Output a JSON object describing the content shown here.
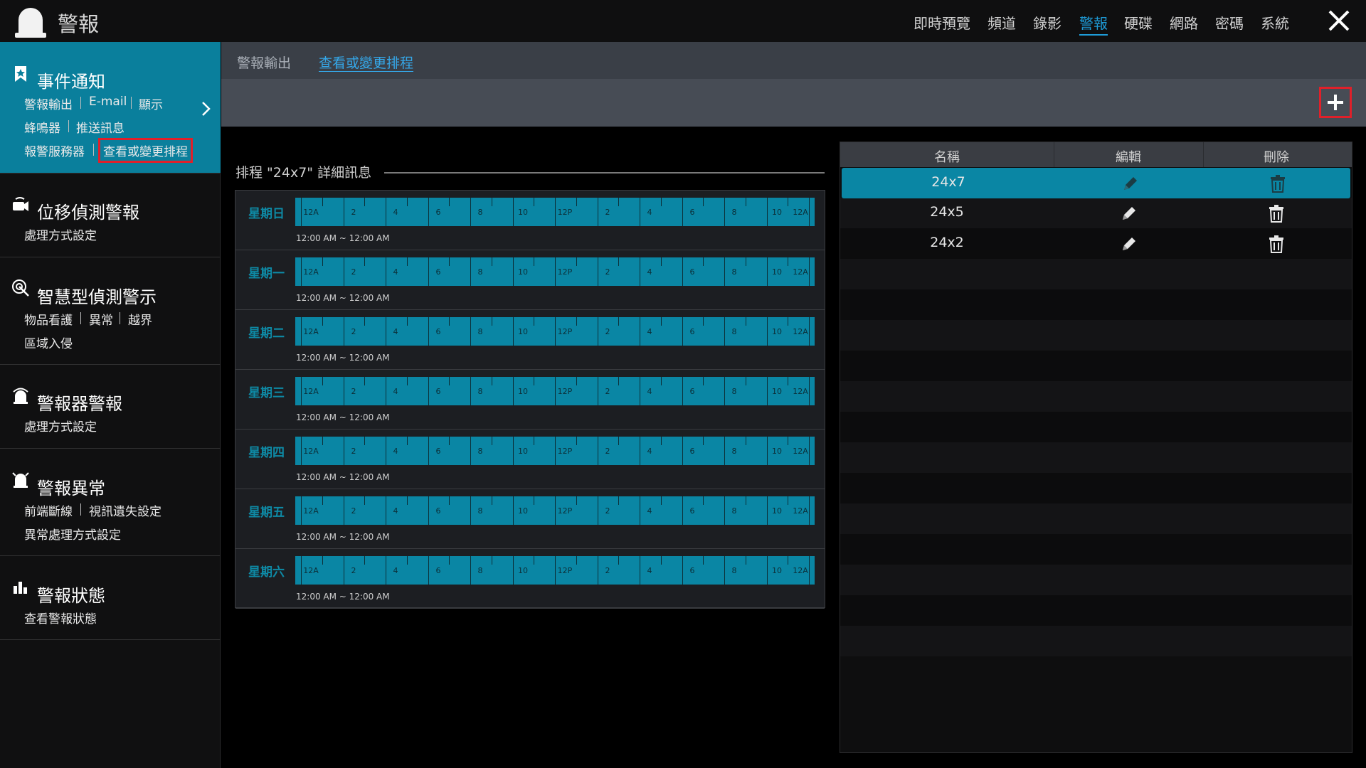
{
  "header": {
    "title": "警報",
    "nav": [
      {
        "label": "即時預覽",
        "active": false
      },
      {
        "label": "頻道",
        "active": false
      },
      {
        "label": "錄影",
        "active": false
      },
      {
        "label": "警報",
        "active": true
      },
      {
        "label": "硬碟",
        "active": false
      },
      {
        "label": "網路",
        "active": false
      },
      {
        "label": "密碼",
        "active": false
      },
      {
        "label": "系統",
        "active": false
      }
    ],
    "close_icon": "close-icon",
    "app_icon": "alarm-light-icon"
  },
  "sidebar": {
    "sections": [
      {
        "title": "事件通知",
        "icon": "bookmark-icon",
        "active": true,
        "items": [
          "警報輸出",
          "E-mail",
          "顯示",
          "蜂鳴器",
          "推送訊息",
          "報警服務器",
          "查看或變更排程"
        ]
      },
      {
        "title": "位移偵測警報",
        "icon": "motion-icon",
        "items": [
          "處理方式設定"
        ]
      },
      {
        "title": "智慧型偵測警示",
        "icon": "target-icon",
        "items": [
          "物品看護",
          "異常",
          "越界",
          "區域入侵"
        ]
      },
      {
        "title": "警報器警報",
        "icon": "siren-icon",
        "items": [
          "處理方式設定"
        ]
      },
      {
        "title": "警報異常",
        "icon": "alarm-exception-icon",
        "items": [
          "前端斷線",
          "視訊遺失設定",
          "異常處理方式設定"
        ]
      },
      {
        "title": "警報狀態",
        "icon": "status-bars-icon",
        "items": [
          "查看警報狀態"
        ]
      }
    ]
  },
  "tabs": [
    {
      "label": "警報輸出",
      "active": false
    },
    {
      "label": "查看或變更排程",
      "active": true
    }
  ],
  "schedule": {
    "title": "排程 \"24x7\" 詳細訊息",
    "tick_labels": [
      "12A",
      "2",
      "4",
      "6",
      "8",
      "10",
      "12P",
      "2",
      "4",
      "6",
      "8",
      "10",
      "12A"
    ],
    "bar_color": "#0a86a4",
    "days": [
      {
        "name": "星期日",
        "range": "12:00 AM ~ 12:00 AM"
      },
      {
        "name": "星期一",
        "range": "12:00 AM ~ 12:00 AM"
      },
      {
        "name": "星期二",
        "range": "12:00 AM ~ 12:00 AM"
      },
      {
        "name": "星期三",
        "range": "12:00 AM ~ 12:00 AM"
      },
      {
        "name": "星期四",
        "range": "12:00 AM ~ 12:00 AM"
      },
      {
        "name": "星期五",
        "range": "12:00 AM ~ 12:00 AM"
      },
      {
        "name": "星期六",
        "range": "12:00 AM ~ 12:00 AM"
      }
    ]
  },
  "list": {
    "columns": [
      "名稱",
      "編輯",
      "刪除"
    ],
    "rows": [
      {
        "name": "24x7",
        "selected": true
      },
      {
        "name": "24x5",
        "selected": false
      },
      {
        "name": "24x2",
        "selected": false
      }
    ],
    "edit_icon": "pencil-icon",
    "delete_icon": "trash-icon"
  },
  "toolbar": {
    "add_icon": "plus-icon"
  }
}
